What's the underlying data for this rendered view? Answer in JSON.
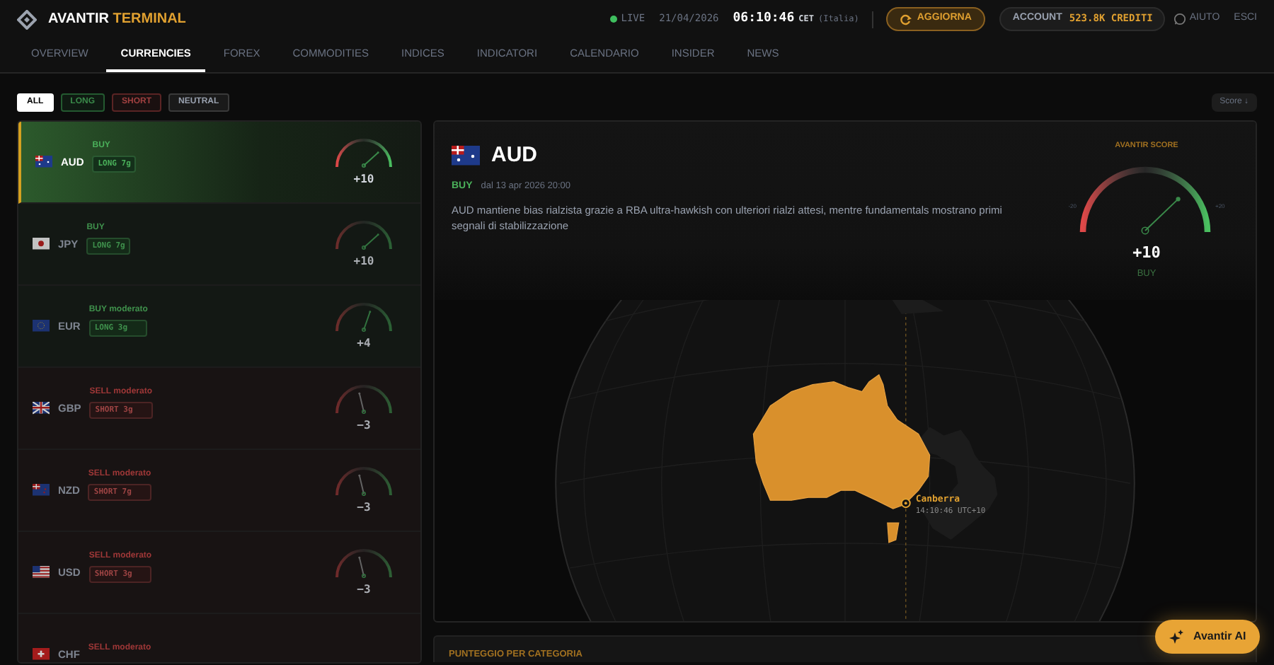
{
  "brand": {
    "name": "AVANTIR",
    "suffix": "TERMINAL"
  },
  "status": {
    "live": "LIVE",
    "date": "21/04/2026",
    "time": "06:10:46",
    "zone": "CET",
    "place": "(Italia)"
  },
  "refresh_button": "AGGIORNA",
  "account": {
    "label": "ACCOUNT",
    "credits": "523.8K CREDITI"
  },
  "help": "AIUTO",
  "logout": "ESCI",
  "tabs": [
    {
      "label": "OVERVIEW",
      "selected": false
    },
    {
      "label": "CURRENCIES",
      "selected": true
    },
    {
      "label": "FOREX",
      "selected": false
    },
    {
      "label": "COMMODITIES",
      "selected": false
    },
    {
      "label": "INDICES",
      "selected": false
    },
    {
      "label": "INDICATORI",
      "selected": false
    },
    {
      "label": "CALENDARIO",
      "selected": false
    },
    {
      "label": "INSIDER",
      "selected": false
    },
    {
      "label": "NEWS",
      "selected": false
    }
  ],
  "filters": [
    {
      "label": "ALL",
      "kind": "all",
      "selected": true
    },
    {
      "label": "LONG",
      "kind": "long",
      "selected": false
    },
    {
      "label": "SHORT",
      "kind": "short",
      "selected": false
    },
    {
      "label": "NEUTRAL",
      "kind": "neutral",
      "selected": false
    }
  ],
  "sort_button": "Score ↓",
  "currencies": [
    {
      "code": "AUD",
      "signal": "BUY",
      "badge": "LONG 7g",
      "kind": "long",
      "score": "+10",
      "level": 0.75,
      "selected": true
    },
    {
      "code": "JPY",
      "signal": "BUY",
      "badge": "LONG 7g",
      "kind": "long",
      "score": "+10",
      "level": 0.75,
      "selected": false
    },
    {
      "code": "EUR",
      "signal": "BUY moderato",
      "badge": "LONG 3g",
      "kind": "long",
      "score": "+4",
      "level": 0.6,
      "selected": false
    },
    {
      "code": "GBP",
      "signal": "SELL moderato",
      "badge": "SHORT 3g",
      "kind": "short",
      "score": "−3",
      "level": 0.43,
      "selected": false
    },
    {
      "code": "NZD",
      "signal": "SELL moderato",
      "badge": "SHORT 7g",
      "kind": "short",
      "score": "−3",
      "level": 0.43,
      "selected": false
    },
    {
      "code": "USD",
      "signal": "SELL moderato",
      "badge": "SHORT 3g",
      "kind": "short",
      "score": "−3",
      "level": 0.43,
      "selected": false
    },
    {
      "code": "CHF",
      "signal": "SELL moderato",
      "kind": "short",
      "selected": false
    }
  ],
  "detail": {
    "code": "AUD",
    "signal": "BUY",
    "since": "dal 13 apr 2026 20:00",
    "description": "AUD mantiene bias rialzista grazie a RBA ultra-hawkish con ulteriori rialzi attesi, mentre fundamentals mostrano primi segnali di stabilizzazione",
    "score_title": "AVANTIR SCORE",
    "min": "-20",
    "max": "+20",
    "score": "+10",
    "level": 0.75,
    "score_signal": "BUY"
  },
  "map": {
    "city": "Canberra",
    "local_time": "14:10:46 UTC+10"
  },
  "category_title": "PUNTEGGIO PER CATEGORIA",
  "ai_button": "Avantir AI"
}
